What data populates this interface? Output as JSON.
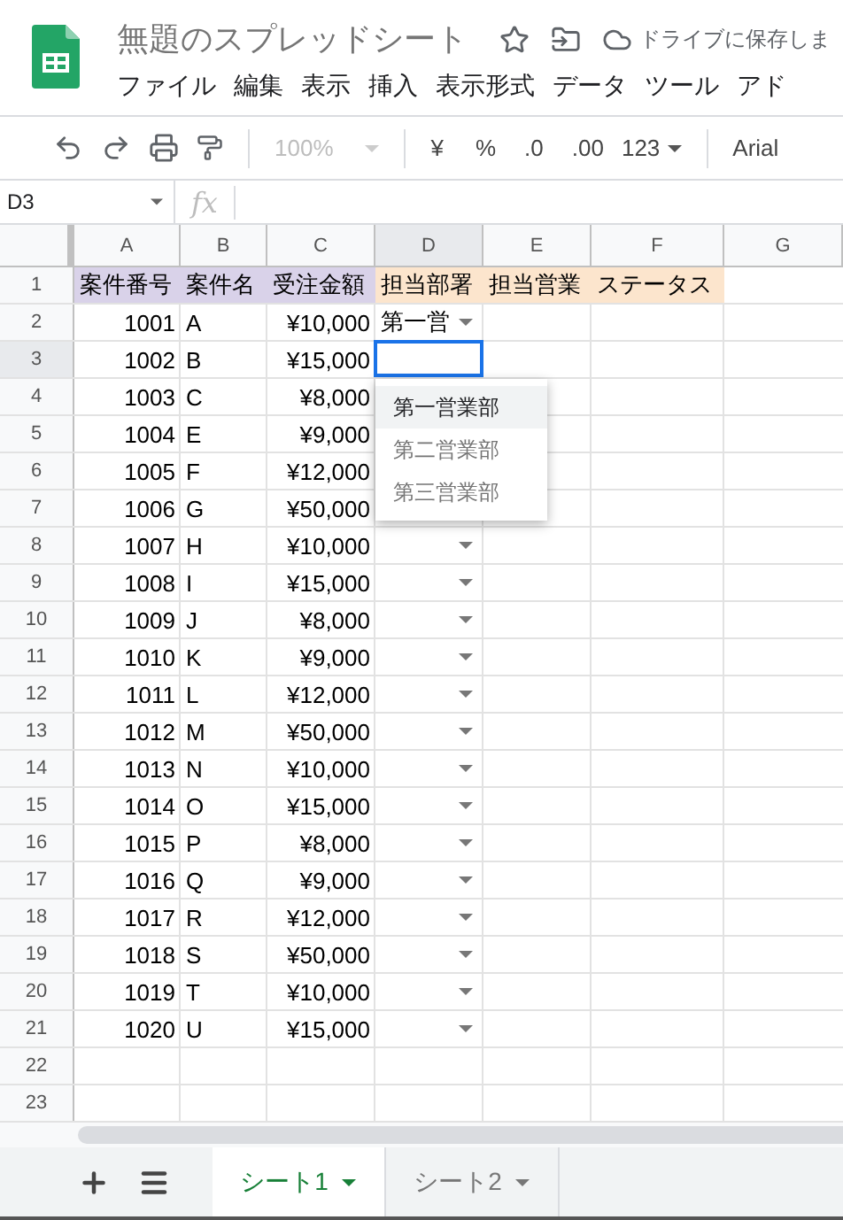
{
  "title": "無題のスプレッドシート",
  "save_status": "ドライブに保存しま",
  "menu": [
    "ファイル",
    "編集",
    "表示",
    "挿入",
    "表示形式",
    "データ",
    "ツール",
    "アド"
  ],
  "toolbar": {
    "zoom": "100%",
    "currency": "¥",
    "percent": "%",
    "decrease_decimal": ".0",
    "increase_decimal": ".00",
    "number_format": "123",
    "font": "Arial"
  },
  "name_box": "D3",
  "fx": "fx",
  "columns": [
    {
      "label": "A",
      "selected": false
    },
    {
      "label": "B",
      "selected": false
    },
    {
      "label": "C",
      "selected": false
    },
    {
      "label": "D",
      "selected": true
    },
    {
      "label": "E",
      "selected": false
    },
    {
      "label": "F",
      "selected": false
    },
    {
      "label": "G",
      "selected": false
    }
  ],
  "header_row": {
    "number": "1",
    "cells": [
      {
        "text": "案件番号",
        "color": "#d9d2e9"
      },
      {
        "text": "案件名",
        "color": "#d9d2e9"
      },
      {
        "text": "受注金額",
        "color": "#d9d2e9"
      },
      {
        "text": "担当部署",
        "color": "#fce5cd"
      },
      {
        "text": "担当営業",
        "color": "#fce5cd"
      },
      {
        "text": "ステータス",
        "color": "#fce5cd"
      }
    ]
  },
  "rows": [
    {
      "number": "2",
      "id": "1001",
      "name": "A",
      "amount": "¥10,000",
      "dept": "第一営",
      "dropdown": true,
      "selected": false
    },
    {
      "number": "3",
      "id": "1002",
      "name": "B",
      "amount": "¥15,000",
      "dropdown": false,
      "selected": true
    },
    {
      "number": "4",
      "id": "1003",
      "name": "C",
      "amount": "¥8,000",
      "dropdown": false,
      "selected": false
    },
    {
      "number": "5",
      "id": "1004",
      "name": "E",
      "amount": "¥9,000",
      "dropdown": false,
      "selected": false
    },
    {
      "number": "6",
      "id": "1005",
      "name": "F",
      "amount": "¥12,000",
      "dropdown": false,
      "selected": false
    },
    {
      "number": "7",
      "id": "1006",
      "name": "G",
      "amount": "¥50,000",
      "dropdown": false,
      "selected": false
    },
    {
      "number": "8",
      "id": "1007",
      "name": "H",
      "amount": "¥10,000",
      "dropdown": true,
      "selected": false
    },
    {
      "number": "9",
      "id": "1008",
      "name": "I",
      "amount": "¥15,000",
      "dropdown": true,
      "selected": false
    },
    {
      "number": "10",
      "id": "1009",
      "name": "J",
      "amount": "¥8,000",
      "dropdown": true,
      "selected": false
    },
    {
      "number": "11",
      "id": "1010",
      "name": "K",
      "amount": "¥9,000",
      "dropdown": true,
      "selected": false
    },
    {
      "number": "12",
      "id": "1011",
      "name": "L",
      "amount": "¥12,000",
      "dropdown": true,
      "selected": false
    },
    {
      "number": "13",
      "id": "1012",
      "name": "M",
      "amount": "¥50,000",
      "dropdown": true,
      "selected": false
    },
    {
      "number": "14",
      "id": "1013",
      "name": "N",
      "amount": "¥10,000",
      "dropdown": true,
      "selected": false
    },
    {
      "number": "15",
      "id": "1014",
      "name": "O",
      "amount": "¥15,000",
      "dropdown": true,
      "selected": false
    },
    {
      "number": "16",
      "id": "1015",
      "name": "P",
      "amount": "¥8,000",
      "dropdown": true,
      "selected": false
    },
    {
      "number": "17",
      "id": "1016",
      "name": "Q",
      "amount": "¥9,000",
      "dropdown": true,
      "selected": false
    },
    {
      "number": "18",
      "id": "1017",
      "name": "R",
      "amount": "¥12,000",
      "dropdown": true,
      "selected": false
    },
    {
      "number": "19",
      "id": "1018",
      "name": "S",
      "amount": "¥50,000",
      "dropdown": true,
      "selected": false
    },
    {
      "number": "20",
      "id": "1019",
      "name": "T",
      "amount": "¥10,000",
      "dropdown": true,
      "selected": false
    },
    {
      "number": "21",
      "id": "1020",
      "name": "U",
      "amount": "¥15,000",
      "dropdown": true,
      "selected": false
    },
    {
      "number": "22",
      "dropdown": false,
      "selected": false
    },
    {
      "number": "23",
      "dropdown": false,
      "selected": false
    }
  ],
  "dropdown_menu": {
    "options": [
      {
        "label": "第一営業部",
        "selected": true
      },
      {
        "label": "第二営業部",
        "selected": false
      },
      {
        "label": "第三営業部",
        "selected": false
      }
    ]
  },
  "sheets": [
    {
      "label": "シート1",
      "selected": true
    },
    {
      "label": "シート2",
      "selected": false
    }
  ]
}
